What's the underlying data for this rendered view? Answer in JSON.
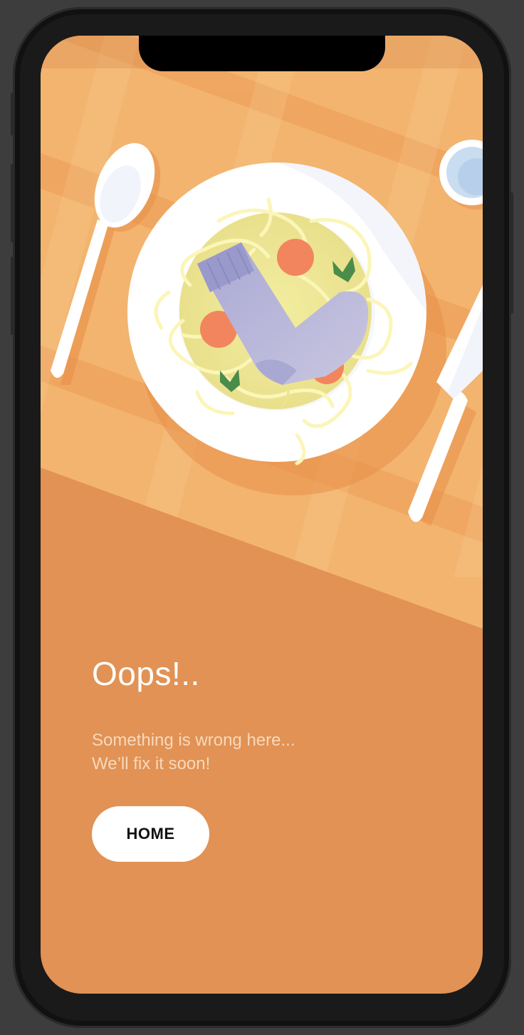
{
  "error_page": {
    "title": "Oops!..",
    "message_line1": "Something is wrong here...",
    "message_line2": "We’ll fix it soon!",
    "home_button_label": "HOME"
  },
  "colors": {
    "background": "#e19254",
    "tablecloth": "#f3b46f",
    "title_text": "#ffffff",
    "message_text": "#f7d9bd",
    "button_bg": "#ffffff",
    "button_text": "#111111"
  },
  "illustration": {
    "icons": [
      "spoon-icon",
      "plate-icon",
      "pasta-icon",
      "sock-icon",
      "knife-icon",
      "glass-icon"
    ]
  }
}
